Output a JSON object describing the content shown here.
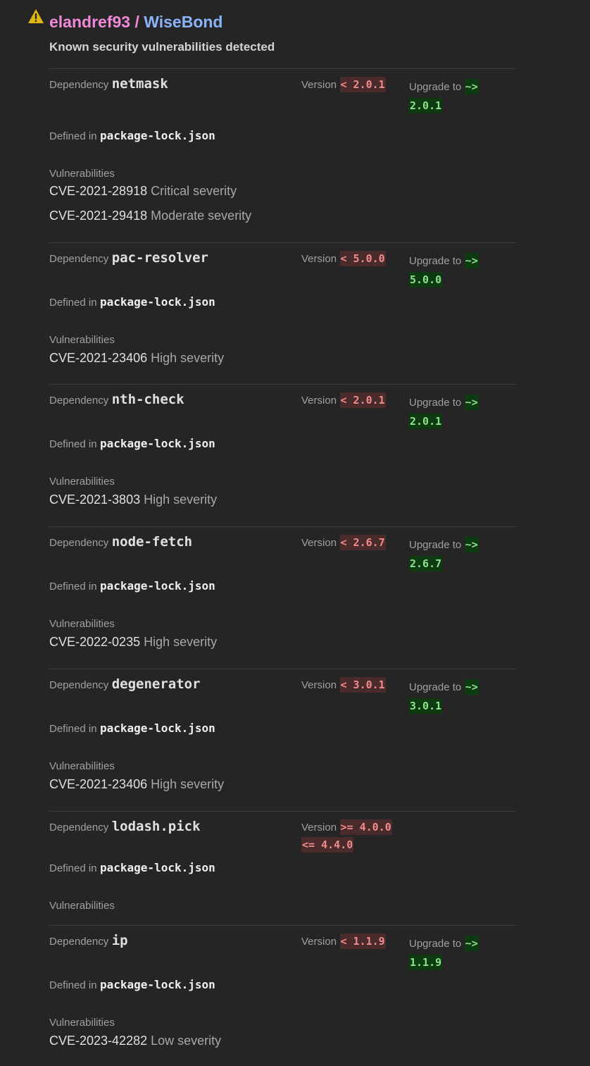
{
  "header": {
    "owner": "elandref93",
    "separator": " / ",
    "repo": "WiseBond",
    "subtitle": "Known security vulnerabilities detected"
  },
  "labels": {
    "dependency": "Dependency",
    "version": "Version",
    "upgrade_to": "Upgrade to",
    "defined_in": "Defined in",
    "vulnerabilities": "Vulnerabilities"
  },
  "dependencies": [
    {
      "name": "netmask",
      "version": "< 2.0.1",
      "upgrade_prefix": "~>",
      "upgrade_version": "2.0.1",
      "defined_in": "package-lock.json",
      "vulnerabilities": [
        {
          "id": "CVE-2021-28918",
          "severity": "Critical severity"
        },
        {
          "id": "CVE-2021-29418",
          "severity": "Moderate severity"
        }
      ]
    },
    {
      "name": "pac-resolver",
      "version": "< 5.0.0",
      "upgrade_prefix": "~>",
      "upgrade_version": "5.0.0",
      "defined_in": "package-lock.json",
      "vulnerabilities": [
        {
          "id": "CVE-2021-23406",
          "severity": "High severity"
        }
      ]
    },
    {
      "name": "nth-check",
      "version": "< 2.0.1",
      "upgrade_prefix": "~>",
      "upgrade_version": "2.0.1",
      "defined_in": "package-lock.json",
      "vulnerabilities": [
        {
          "id": "CVE-2021-3803",
          "severity": "High severity"
        }
      ]
    },
    {
      "name": "node-fetch",
      "version": "< 2.6.7",
      "upgrade_prefix": "~>",
      "upgrade_version": "2.6.7",
      "defined_in": "package-lock.json",
      "vulnerabilities": [
        {
          "id": "CVE-2022-0235",
          "severity": "High severity"
        }
      ]
    },
    {
      "name": "degenerator",
      "version": "< 3.0.1",
      "upgrade_prefix": "~>",
      "upgrade_version": "3.0.1",
      "defined_in": "package-lock.json",
      "vulnerabilities": [
        {
          "id": "CVE-2021-23406",
          "severity": "High severity"
        }
      ]
    },
    {
      "name": "lodash.pick",
      "version": ">= 4.0.0",
      "version_line2": "<= 4.4.0",
      "defined_in": "package-lock.json",
      "vulnerabilities": []
    },
    {
      "name": "ip",
      "version": "< 1.1.9",
      "upgrade_prefix": "~>",
      "upgrade_version": "1.1.9",
      "defined_in": "package-lock.json",
      "vulnerabilities": [
        {
          "id": "CVE-2023-42282",
          "severity": "Low severity"
        }
      ]
    }
  ],
  "colors": {
    "background": "#252526",
    "owner": "#f08ad8",
    "repo": "#8ab4f8",
    "version_fg": "#f08c8c",
    "version_bg": "#4a2b2b",
    "upgrade_fg": "#8fe08f",
    "upgrade_bg": "#0e3a12",
    "warning": "#e2b614"
  }
}
